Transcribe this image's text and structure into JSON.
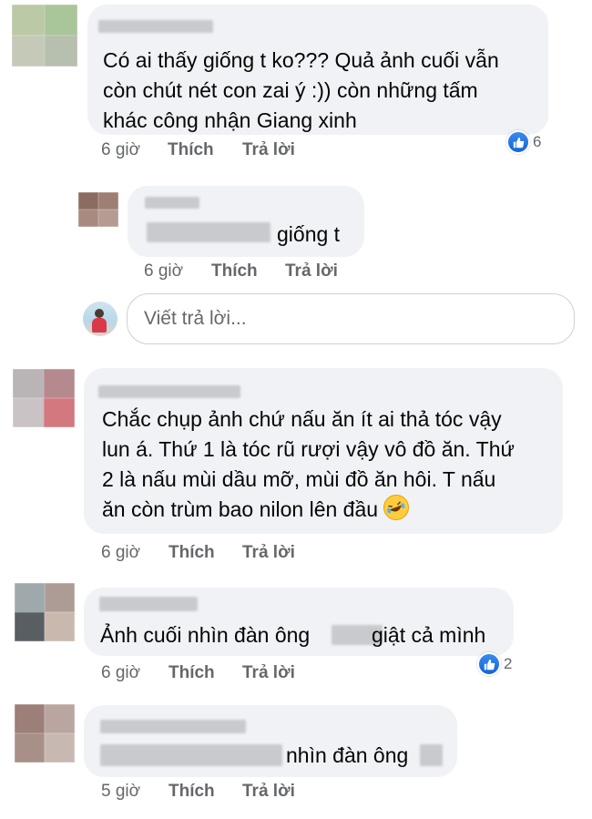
{
  "comments": [
    {
      "text_lines": [
        "Có ai thấy giống t ko??? Quả ảnh cuối vẫn",
        "còn chút nét con zai ý :)) còn những tấm",
        "khác công nhận Giang xinh"
      ],
      "time": "6 giờ",
      "like_label": "Thích",
      "reply_label": "Trả lời",
      "reaction_count": "6"
    },
    {
      "text_lines": [
        "giống t"
      ],
      "time": "6 giờ",
      "like_label": "Thích",
      "reply_label": "Trả lời"
    },
    {
      "text_lines": [
        "Chắc chụp ảnh chứ nấu ăn ít ai thả tóc vậy",
        "lun á. Thứ 1 là tóc rũ rượi vậy vô đồ ăn. Thứ",
        "2 là nấu mùi dầu mỡ, mùi đồ ăn hôi. T nấu",
        "ăn còn trùm bao nilon lên đầu"
      ],
      "emoji": "rolling-on-floor-laughing",
      "time": "6 giờ",
      "like_label": "Thích",
      "reply_label": "Trả lời"
    },
    {
      "text_a": "Ảnh cuối nhìn đàn ông",
      "text_b": "giật cả mình",
      "time": "6 giờ",
      "like_label": "Thích",
      "reply_label": "Trả lời",
      "reaction_count": "2"
    },
    {
      "text_a": "nhìn đàn ông",
      "time": "5 giờ",
      "like_label": "Thích",
      "reply_label": "Trả lời"
    }
  ],
  "reply_input": {
    "placeholder": "Viết trả lời..."
  },
  "colors": {
    "bubble": "#f0f2f5",
    "meta": "#65676b",
    "like": "#1877f2"
  }
}
